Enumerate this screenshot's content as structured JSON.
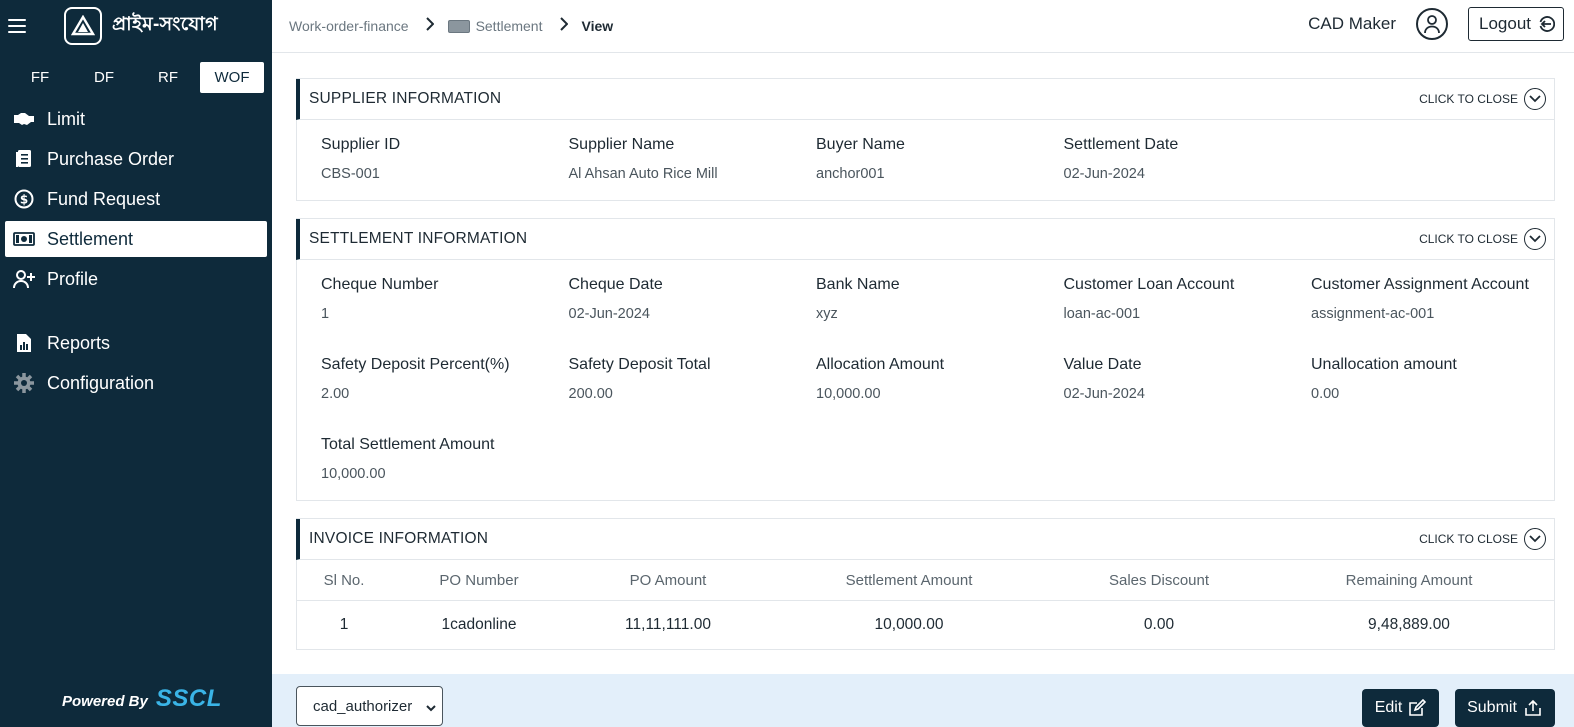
{
  "app": {
    "brand": "প্রাইম-সংযোগ",
    "powered_prefix": "Powered By",
    "powered_brand": "SSCL"
  },
  "segments": [
    {
      "label": "FF",
      "active": false
    },
    {
      "label": "DF",
      "active": false
    },
    {
      "label": "RF",
      "active": false
    },
    {
      "label": "WOF",
      "active": true
    }
  ],
  "nav": {
    "limit": "Limit",
    "purchase_order": "Purchase Order",
    "fund_request": "Fund Request",
    "settlement": "Settlement",
    "profile": "Profile",
    "reports": "Reports",
    "configuration": "Configuration"
  },
  "breadcrumb": {
    "root": "Work-order-finance",
    "section": "Settlement",
    "current": "View"
  },
  "header": {
    "user": "CAD Maker",
    "logout": "Logout"
  },
  "collapse_label": "CLICK TO CLOSE",
  "supplier": {
    "title": "SUPPLIER INFORMATION",
    "fields": [
      {
        "label": "Supplier ID",
        "value": "CBS-001"
      },
      {
        "label": "Supplier Name",
        "value": "Al Ahsan Auto Rice Mill"
      },
      {
        "label": "Buyer Name",
        "value": "anchor001"
      },
      {
        "label": "Settlement Date",
        "value": "02-Jun-2024"
      }
    ]
  },
  "settlement": {
    "title": "SETTLEMENT INFORMATION",
    "fields": [
      {
        "label": "Cheque Number",
        "value": "1"
      },
      {
        "label": "Cheque Date",
        "value": "02-Jun-2024"
      },
      {
        "label": "Bank Name",
        "value": "xyz"
      },
      {
        "label": "Customer Loan Account",
        "value": "loan-ac-001"
      },
      {
        "label": "Customer Assignment Account",
        "value": "assignment-ac-001"
      },
      {
        "label": "Safety Deposit Percent(%)",
        "value": "2.00"
      },
      {
        "label": "Safety Deposit Total",
        "value": "200.00"
      },
      {
        "label": "Allocation Amount",
        "value": "10,000.00"
      },
      {
        "label": "Value Date",
        "value": "02-Jun-2024"
      },
      {
        "label": "Unallocation amount",
        "value": "0.00"
      },
      {
        "label": "Total Settlement Amount",
        "value": "10,000.00"
      }
    ]
  },
  "invoice": {
    "title": "INVOICE INFORMATION",
    "columns": [
      "Sl No.",
      "PO Number",
      "PO Amount",
      "Settlement Amount",
      "Sales Discount",
      "Remaining Amount"
    ],
    "rows": [
      [
        "1",
        "1cadonline",
        "11,11,111.00",
        "10,000.00",
        "0.00",
        "9,48,889.00"
      ]
    ]
  },
  "footer": {
    "select_value": "cad_authorizer",
    "edit": "Edit",
    "submit": "Submit"
  }
}
